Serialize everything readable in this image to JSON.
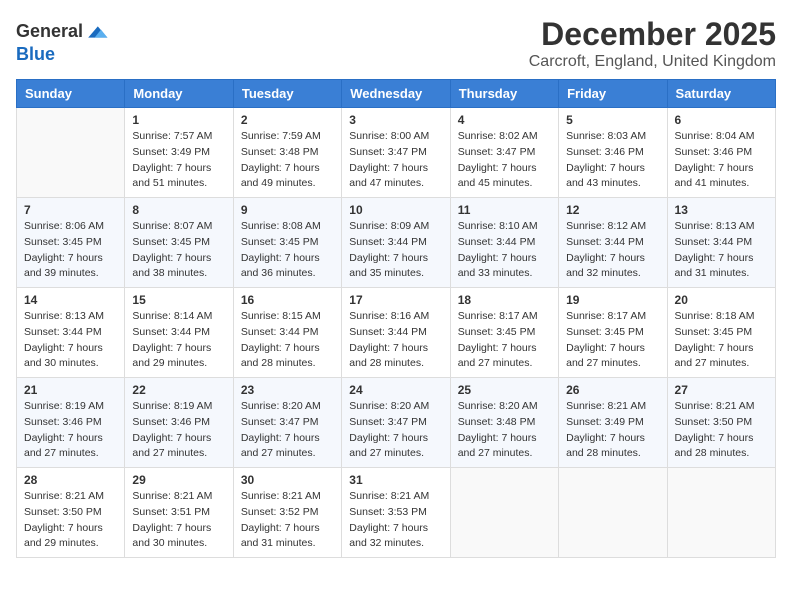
{
  "header": {
    "logo_line1": "General",
    "logo_line2": "Blue",
    "month_title": "December 2025",
    "location": "Carcroft, England, United Kingdom"
  },
  "calendar": {
    "days_of_week": [
      "Sunday",
      "Monday",
      "Tuesday",
      "Wednesday",
      "Thursday",
      "Friday",
      "Saturday"
    ],
    "weeks": [
      [
        {
          "day": "",
          "info": ""
        },
        {
          "day": "1",
          "info": "Sunrise: 7:57 AM\nSunset: 3:49 PM\nDaylight: 7 hours\nand 51 minutes."
        },
        {
          "day": "2",
          "info": "Sunrise: 7:59 AM\nSunset: 3:48 PM\nDaylight: 7 hours\nand 49 minutes."
        },
        {
          "day": "3",
          "info": "Sunrise: 8:00 AM\nSunset: 3:47 PM\nDaylight: 7 hours\nand 47 minutes."
        },
        {
          "day": "4",
          "info": "Sunrise: 8:02 AM\nSunset: 3:47 PM\nDaylight: 7 hours\nand 45 minutes."
        },
        {
          "day": "5",
          "info": "Sunrise: 8:03 AM\nSunset: 3:46 PM\nDaylight: 7 hours\nand 43 minutes."
        },
        {
          "day": "6",
          "info": "Sunrise: 8:04 AM\nSunset: 3:46 PM\nDaylight: 7 hours\nand 41 minutes."
        }
      ],
      [
        {
          "day": "7",
          "info": "Sunrise: 8:06 AM\nSunset: 3:45 PM\nDaylight: 7 hours\nand 39 minutes."
        },
        {
          "day": "8",
          "info": "Sunrise: 8:07 AM\nSunset: 3:45 PM\nDaylight: 7 hours\nand 38 minutes."
        },
        {
          "day": "9",
          "info": "Sunrise: 8:08 AM\nSunset: 3:45 PM\nDaylight: 7 hours\nand 36 minutes."
        },
        {
          "day": "10",
          "info": "Sunrise: 8:09 AM\nSunset: 3:44 PM\nDaylight: 7 hours\nand 35 minutes."
        },
        {
          "day": "11",
          "info": "Sunrise: 8:10 AM\nSunset: 3:44 PM\nDaylight: 7 hours\nand 33 minutes."
        },
        {
          "day": "12",
          "info": "Sunrise: 8:12 AM\nSunset: 3:44 PM\nDaylight: 7 hours\nand 32 minutes."
        },
        {
          "day": "13",
          "info": "Sunrise: 8:13 AM\nSunset: 3:44 PM\nDaylight: 7 hours\nand 31 minutes."
        }
      ],
      [
        {
          "day": "14",
          "info": "Sunrise: 8:13 AM\nSunset: 3:44 PM\nDaylight: 7 hours\nand 30 minutes."
        },
        {
          "day": "15",
          "info": "Sunrise: 8:14 AM\nSunset: 3:44 PM\nDaylight: 7 hours\nand 29 minutes."
        },
        {
          "day": "16",
          "info": "Sunrise: 8:15 AM\nSunset: 3:44 PM\nDaylight: 7 hours\nand 28 minutes."
        },
        {
          "day": "17",
          "info": "Sunrise: 8:16 AM\nSunset: 3:44 PM\nDaylight: 7 hours\nand 28 minutes."
        },
        {
          "day": "18",
          "info": "Sunrise: 8:17 AM\nSunset: 3:45 PM\nDaylight: 7 hours\nand 27 minutes."
        },
        {
          "day": "19",
          "info": "Sunrise: 8:17 AM\nSunset: 3:45 PM\nDaylight: 7 hours\nand 27 minutes."
        },
        {
          "day": "20",
          "info": "Sunrise: 8:18 AM\nSunset: 3:45 PM\nDaylight: 7 hours\nand 27 minutes."
        }
      ],
      [
        {
          "day": "21",
          "info": "Sunrise: 8:19 AM\nSunset: 3:46 PM\nDaylight: 7 hours\nand 27 minutes."
        },
        {
          "day": "22",
          "info": "Sunrise: 8:19 AM\nSunset: 3:46 PM\nDaylight: 7 hours\nand 27 minutes."
        },
        {
          "day": "23",
          "info": "Sunrise: 8:20 AM\nSunset: 3:47 PM\nDaylight: 7 hours\nand 27 minutes."
        },
        {
          "day": "24",
          "info": "Sunrise: 8:20 AM\nSunset: 3:47 PM\nDaylight: 7 hours\nand 27 minutes."
        },
        {
          "day": "25",
          "info": "Sunrise: 8:20 AM\nSunset: 3:48 PM\nDaylight: 7 hours\nand 27 minutes."
        },
        {
          "day": "26",
          "info": "Sunrise: 8:21 AM\nSunset: 3:49 PM\nDaylight: 7 hours\nand 28 minutes."
        },
        {
          "day": "27",
          "info": "Sunrise: 8:21 AM\nSunset: 3:50 PM\nDaylight: 7 hours\nand 28 minutes."
        }
      ],
      [
        {
          "day": "28",
          "info": "Sunrise: 8:21 AM\nSunset: 3:50 PM\nDaylight: 7 hours\nand 29 minutes."
        },
        {
          "day": "29",
          "info": "Sunrise: 8:21 AM\nSunset: 3:51 PM\nDaylight: 7 hours\nand 30 minutes."
        },
        {
          "day": "30",
          "info": "Sunrise: 8:21 AM\nSunset: 3:52 PM\nDaylight: 7 hours\nand 31 minutes."
        },
        {
          "day": "31",
          "info": "Sunrise: 8:21 AM\nSunset: 3:53 PM\nDaylight: 7 hours\nand 32 minutes."
        },
        {
          "day": "",
          "info": ""
        },
        {
          "day": "",
          "info": ""
        },
        {
          "day": "",
          "info": ""
        }
      ]
    ]
  }
}
